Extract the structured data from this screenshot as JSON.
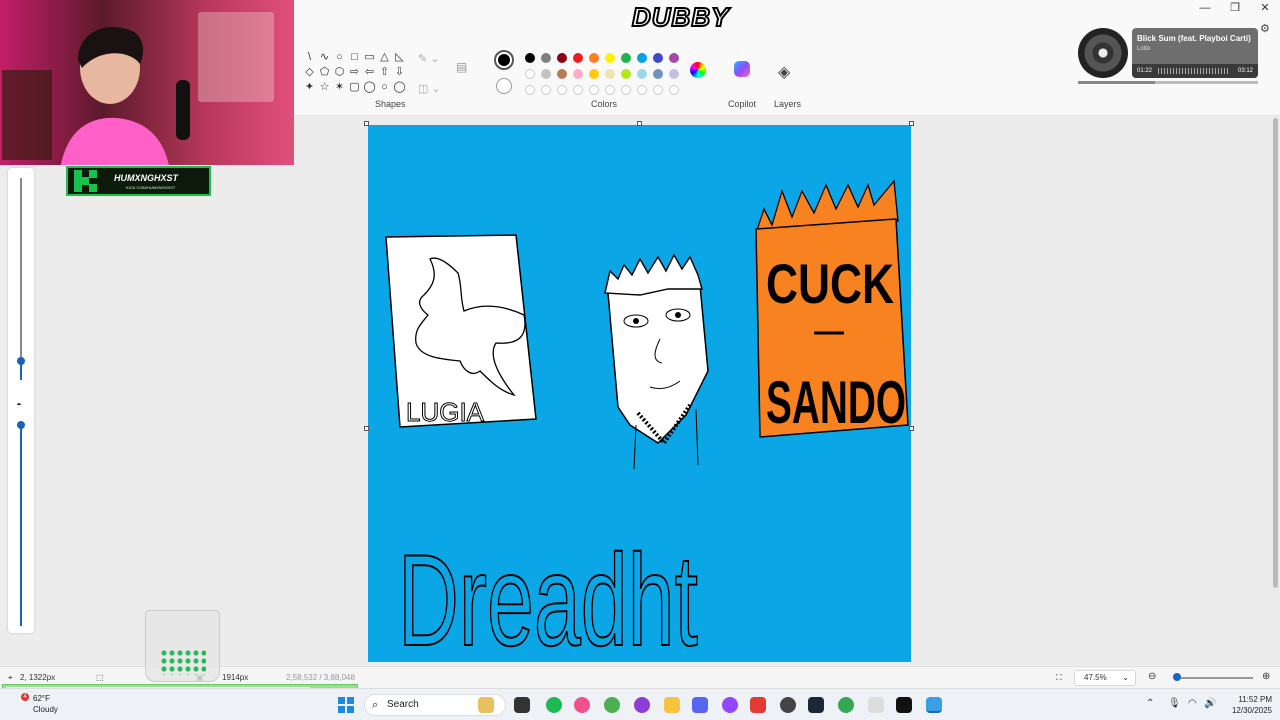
{
  "window": {
    "controls": [
      "—",
      "❐",
      "✕"
    ]
  },
  "ribbon": {
    "shapes_label": "Shapes",
    "shapes": [
      "\\",
      "∿",
      "○",
      "□",
      "▭",
      "△",
      "◺",
      "◇",
      "⬠",
      "⬡",
      "⇨",
      "⇦",
      "⇧",
      "⇩",
      "✦",
      "☆",
      "✶",
      "▢",
      "◯",
      "○",
      "◯"
    ],
    "colors_label": "Colors",
    "copilot_label": "Copilot",
    "layers_label": "Layers",
    "palette": [
      "#000000",
      "#7f7f7f",
      "#880015",
      "#ed1c24",
      "#ff7f27",
      "#fff200",
      "#22b14c",
      "#00a2e8",
      "#3f48cc",
      "#a349a4",
      "#ffffff",
      "#c3c3c3",
      "#b97a57",
      "#ffaec9",
      "#ffc90e",
      "#efe4b0",
      "#b5e61d",
      "#99d9ea",
      "#7092be",
      "#c8bfe7",
      "",
      "",
      "",
      "",
      "",
      "",
      "",
      "",
      "",
      ""
    ]
  },
  "status": {
    "cursor_pos": "2, 1322px",
    "canvas_size": "1914px",
    "file_size": "2,58,532 / 3,88,048",
    "zoom": "47.5%"
  },
  "taskbar": {
    "weather_temp": "62°F",
    "weather_desc": "Cloudy",
    "weather_badge": "4",
    "search_placeholder": "Search",
    "time": "11:52 PM",
    "date": "12/30/2025"
  },
  "overlays": {
    "channel_name": "HUMXNGHXST",
    "channel_url": "KICK.COM/HUMXNGHXST",
    "stream_title": "DUBBY",
    "track_title": "Blick Sum (feat. Playboi Carti)",
    "track_artist": "Lotto",
    "track_elapsed": "01:22",
    "track_total": "03:12",
    "track_progress": 0.43
  },
  "drawing": {
    "lugia_caption": "LUGIA",
    "box_text_top": "CUCK",
    "box_text_dash": "—",
    "box_text_bottom": "SANDO",
    "signature": "Dreadht",
    "canvas_bg": "#0aa6e6",
    "box_color": "#f7821f"
  }
}
